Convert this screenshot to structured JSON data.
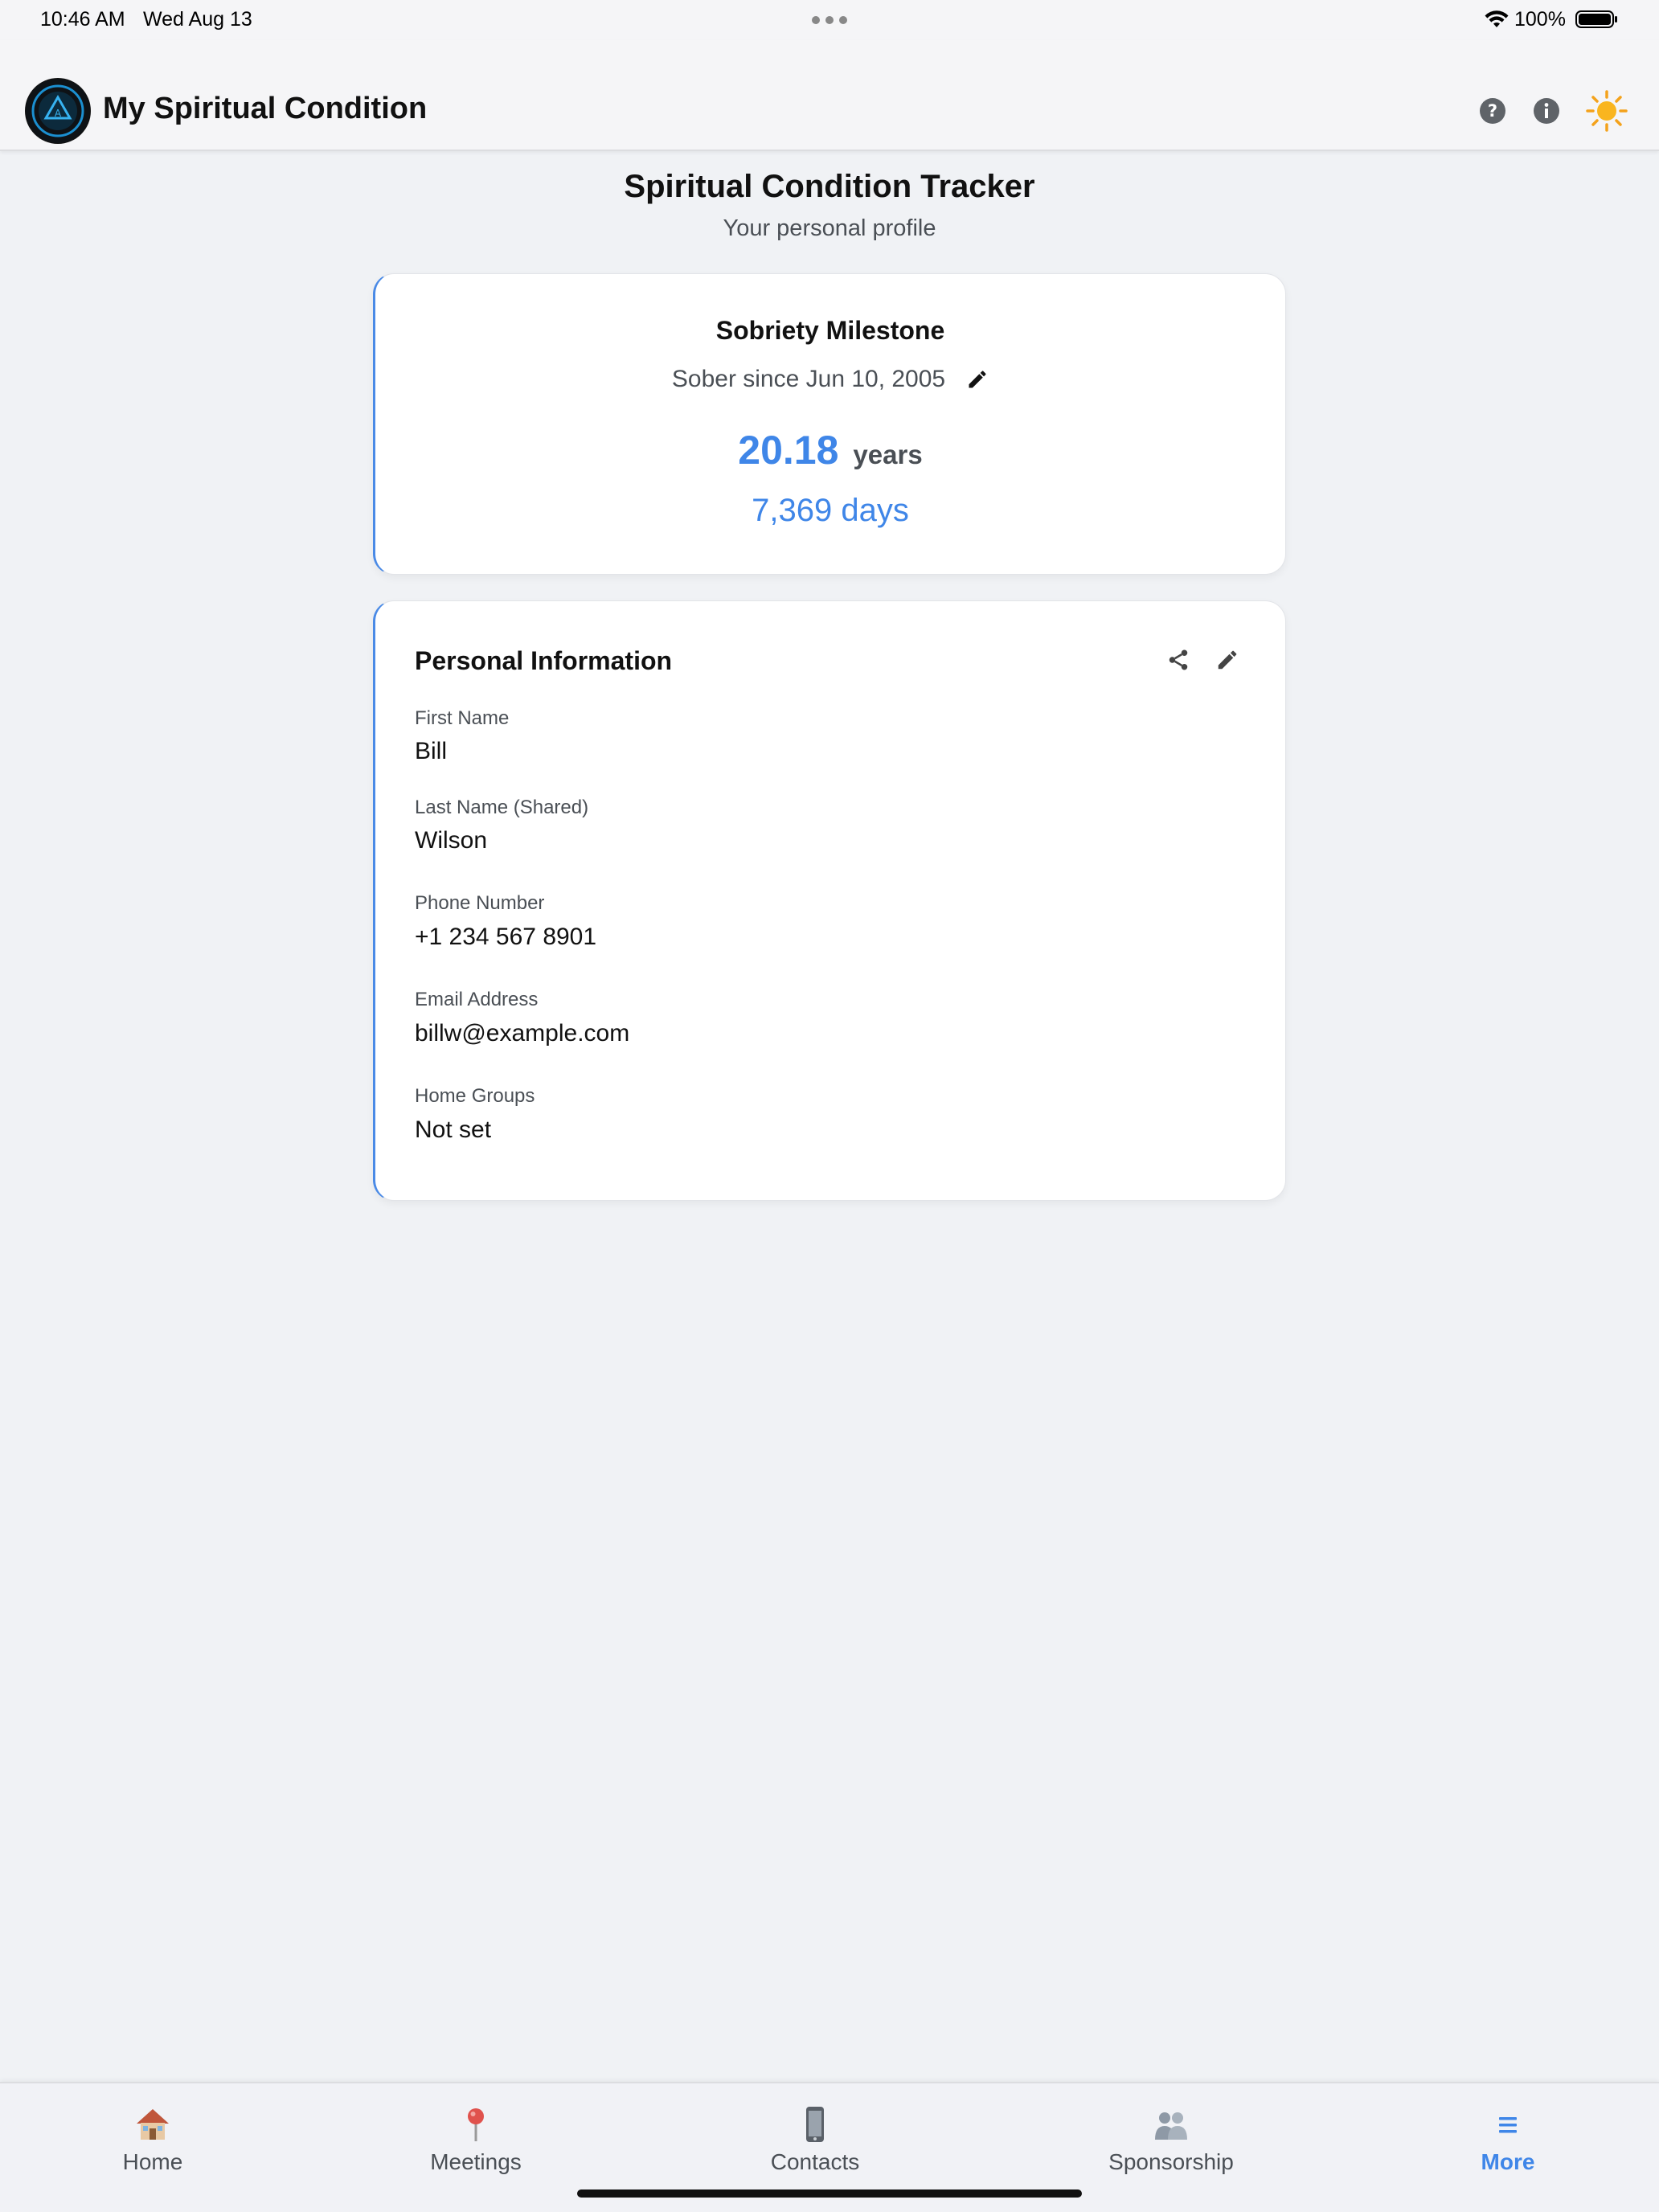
{
  "status_bar": {
    "time": "10:46 AM",
    "date": "Wed Aug 13",
    "battery": "100%"
  },
  "header": {
    "title": "My Spiritual Condition",
    "icons": [
      "app-logo",
      "help-icon",
      "info-icon",
      "sun-icon"
    ]
  },
  "page": {
    "title": "Spiritual Condition Tracker",
    "subtitle": "Your personal profile"
  },
  "milestone": {
    "title": "Sobriety Milestone",
    "since": "Sober since Jun 10, 2005",
    "years_value": "20.18",
    "years_unit": "years",
    "days": "7,369 days"
  },
  "personal_info": {
    "title": "Personal Information",
    "fields": [
      {
        "label": "First Name",
        "value": "Bill"
      },
      {
        "label": "Last Name (Shared)",
        "value": "Wilson"
      },
      {
        "label": "Phone Number",
        "value": "+1 234 567 8901"
      },
      {
        "label": "Email Address",
        "value": "billw@example.com"
      },
      {
        "label": "Home Groups",
        "value": "Not set"
      }
    ]
  },
  "tabs": [
    {
      "label": "Home",
      "icon": "house-icon"
    },
    {
      "label": "Meetings",
      "icon": "pin-icon"
    },
    {
      "label": "Contacts",
      "icon": "phone-icon"
    },
    {
      "label": "Sponsorship",
      "icon": "people-icon"
    },
    {
      "label": "More",
      "icon": "menu-icon",
      "active": true
    }
  ],
  "colors": {
    "accent": "#3f86e8",
    "background": "#f0f2f5",
    "card": "#ffffff"
  }
}
